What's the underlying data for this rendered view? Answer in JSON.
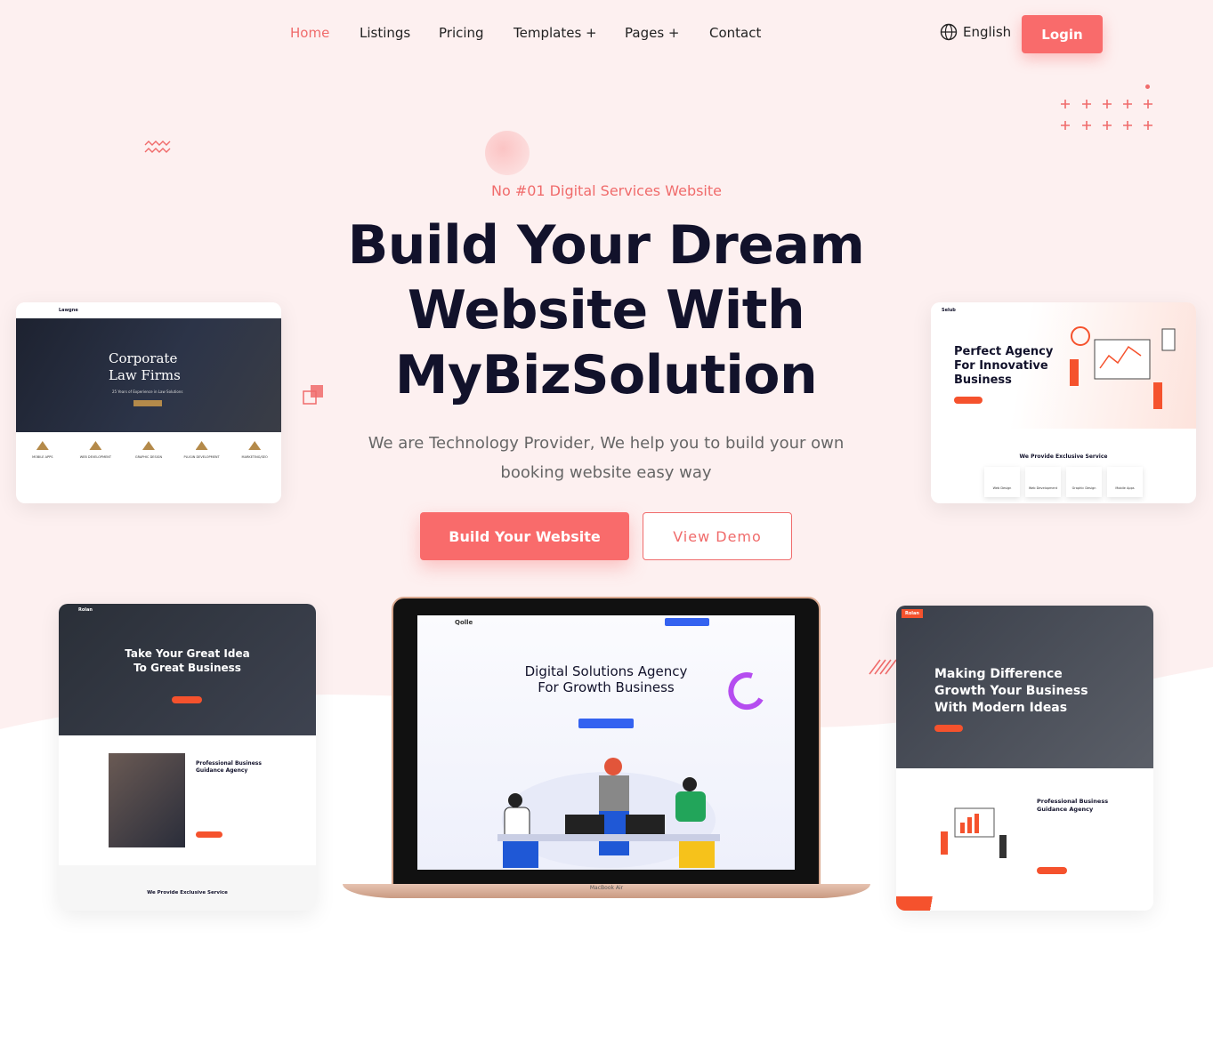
{
  "nav": {
    "items": [
      {
        "label": "Home",
        "active": true
      },
      {
        "label": "Listings"
      },
      {
        "label": "Pricing"
      },
      {
        "label": "Templates +"
      },
      {
        "label": "Pages +"
      },
      {
        "label": "Contact"
      }
    ],
    "language": "English",
    "login": "Login"
  },
  "hero": {
    "eyebrow": "No #01 Digital Services Website",
    "headline_1": "Build Your Dream",
    "headline_2": "Website With",
    "headline_3": "MyBizSolution",
    "subtitle_1": "We are Technology Provider, We help you to build your own",
    "subtitle_2": "booking website easy way",
    "primary_button": "Build Your Website",
    "secondary_button": "View Demo"
  },
  "previews": {
    "law": {
      "logo": "Lawgne",
      "title_1": "Corporate",
      "title_2": "Law Firms",
      "subtitle": "25 Years of Experience in Law Solutions",
      "services": [
        "MOBILE APPS",
        "WEB DEVELOPMENT",
        "GRAPHIC DESIGN",
        "PLUGIN DEVELOPMENT",
        "MARKETING/SEO"
      ]
    },
    "agency": {
      "logo": "Selub",
      "title_1": "Perfect Agency",
      "title_2": "For Innovative",
      "title_3": "Business",
      "section_title": "We Provide Exclusive Service",
      "services": [
        "Web Design",
        "Web Development",
        "Graphic Design",
        "Mobile Apps"
      ]
    },
    "rolan": {
      "logo": "Rolan",
      "title_1": "Take Your Great Idea",
      "title_2": "To Great Business",
      "mid_title_1": "Professional Business",
      "mid_title_2": "Guidance Agency",
      "footer_title": "We Provide Exclusive Service"
    },
    "qolle": {
      "logo": "Qolle",
      "title_1": "Digital Solutions Agency",
      "title_2": "For Growth Business",
      "device_label": "MacBook Air"
    },
    "making": {
      "logo": "Rolan",
      "title_1": "Making Difference",
      "title_2": "Growth Your Business",
      "title_3": "With Modern Ideas",
      "mid_title_1": "Professional Business",
      "mid_title_2": "Guidance Agency"
    }
  },
  "colors": {
    "accent": "#f96b6b",
    "dark": "#12122b",
    "hero_bg": "#fdf0f0"
  },
  "icons": [
    "globe-icon",
    "plus-grid-decoration",
    "zigzag-decoration",
    "square-decoration"
  ]
}
